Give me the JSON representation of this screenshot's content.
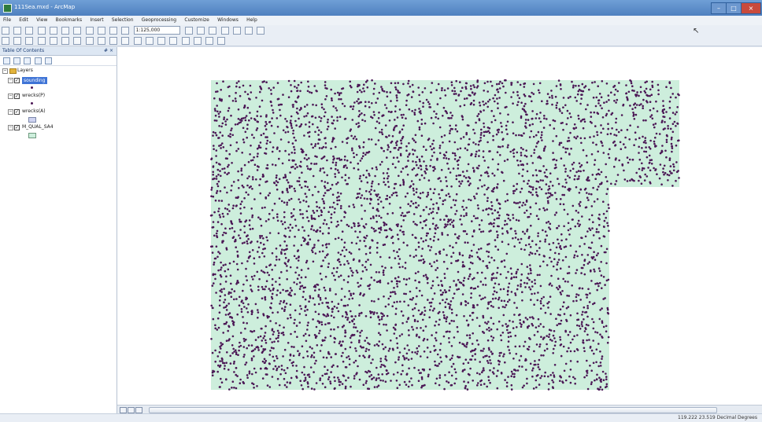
{
  "window": {
    "title": "111Sea.mxd - ArcMap",
    "controls": {
      "minimize": "–",
      "maximize": "□",
      "close": "×"
    }
  },
  "menu": [
    "File",
    "Edit",
    "View",
    "Bookmarks",
    "Insert",
    "Selection",
    "Geoprocessing",
    "Customize",
    "Windows",
    "Help"
  ],
  "toolbar": {
    "scale": "1:125,000"
  },
  "toc": {
    "title": "Table Of Contents",
    "pin": "# ×",
    "group": "Layers",
    "layers": [
      {
        "name": "sounding",
        "checked": true,
        "selected": true,
        "symbol": "point"
      },
      {
        "name": "wrecks(P)",
        "checked": true,
        "selected": false,
        "symbol": "point"
      },
      {
        "name": "wrecks(A)",
        "checked": true,
        "selected": false,
        "symbol": "polygon-lavender"
      },
      {
        "name": "M_QUAL_SA4",
        "checked": true,
        "selected": false,
        "symbol": "polygon-mint"
      }
    ]
  },
  "map": {
    "fill_color": "#cdeedc",
    "point_color": "#4b1755"
  },
  "status": {
    "coordinates": "119.222 23.519 Decimal Degrees"
  }
}
